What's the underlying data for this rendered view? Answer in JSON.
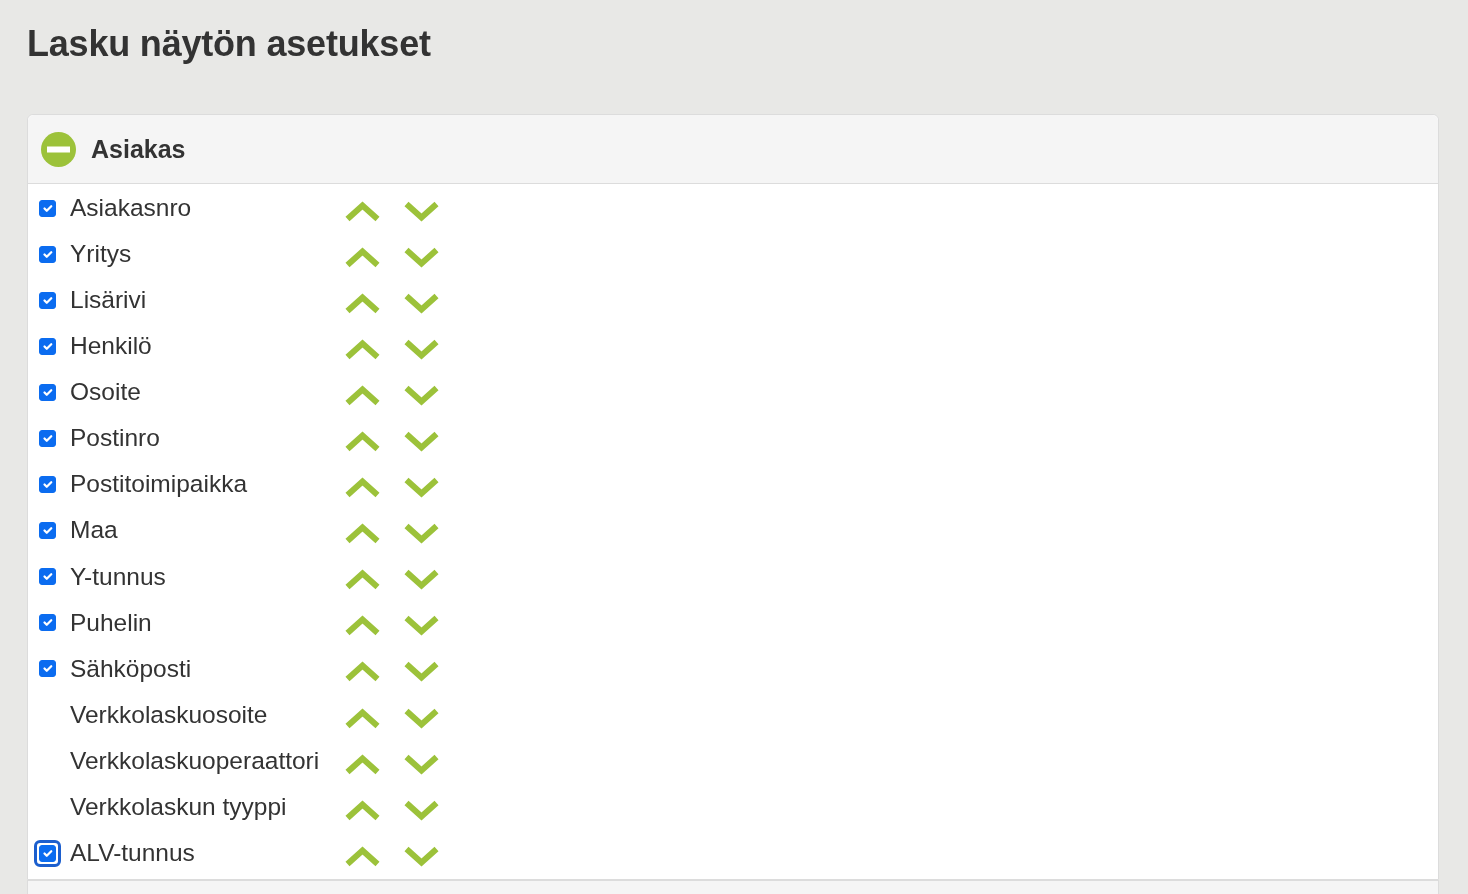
{
  "page": {
    "title": "Lasku näytön asetukset"
  },
  "sections": [
    {
      "title": "Asiakas",
      "expanded": true,
      "fields": [
        {
          "kind": "checkbox",
          "label": "Asiakasnro",
          "checked": true,
          "focused": false
        },
        {
          "kind": "checkbox",
          "label": "Yritys",
          "checked": true,
          "focused": false
        },
        {
          "kind": "checkbox",
          "label": "Lisärivi",
          "checked": true,
          "focused": false
        },
        {
          "kind": "checkbox",
          "label": "Henkilö",
          "checked": true,
          "focused": false
        },
        {
          "kind": "checkbox",
          "label": "Osoite",
          "checked": true,
          "focused": false
        },
        {
          "kind": "checkbox",
          "label": "Postinro",
          "checked": true,
          "focused": false
        },
        {
          "kind": "checkbox",
          "label": "Postitoimipaikka",
          "checked": true,
          "focused": false
        },
        {
          "kind": "checkbox",
          "label": "Maa",
          "checked": true,
          "focused": false
        },
        {
          "kind": "checkbox",
          "label": "Y-tunnus",
          "checked": true,
          "focused": false
        },
        {
          "kind": "checkbox",
          "label": "Puhelin",
          "checked": true,
          "focused": false
        },
        {
          "kind": "checkbox",
          "label": "Sähköposti",
          "checked": true,
          "focused": false
        },
        {
          "kind": "plain",
          "label": "Verkkolaskuosoite"
        },
        {
          "kind": "plain",
          "label": "Verkkolaskuoperaattori"
        },
        {
          "kind": "plain",
          "label": "Verkkolaskun tyyppi"
        },
        {
          "kind": "checkbox",
          "label": "ALV-tunnus",
          "checked": true,
          "focused": true
        }
      ]
    }
  ]
}
